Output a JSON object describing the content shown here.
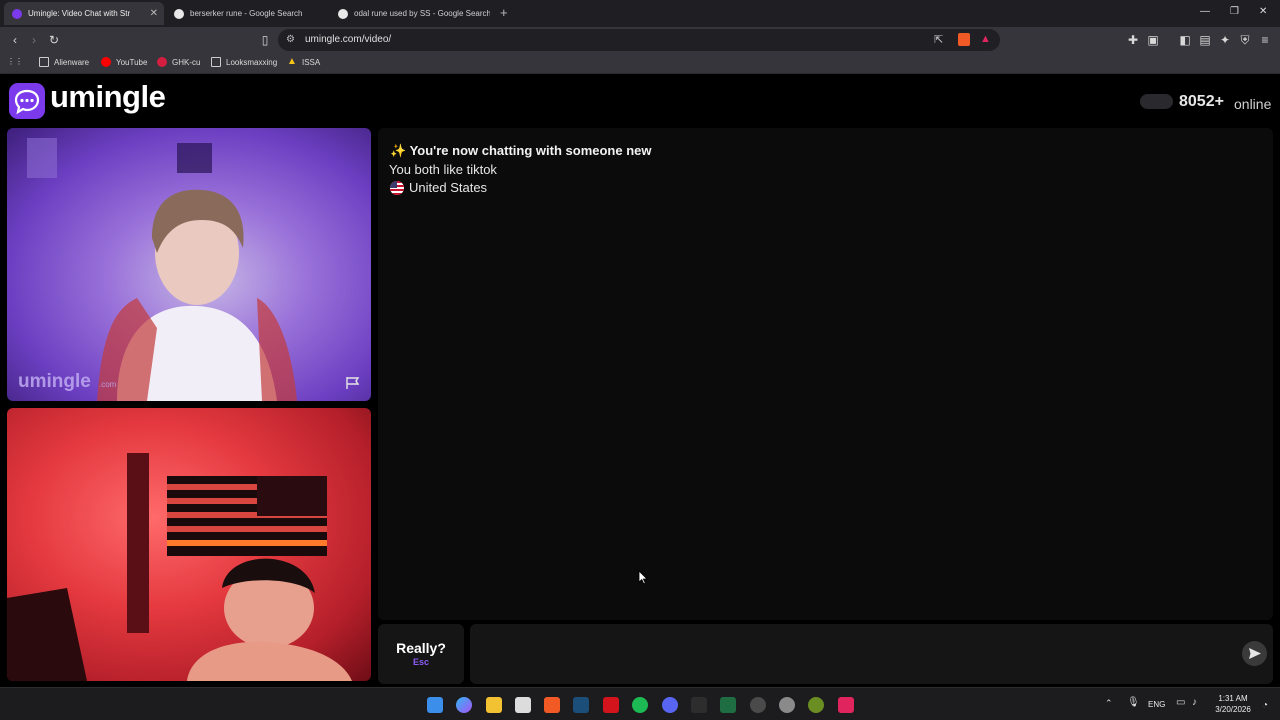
{
  "browser": {
    "tabs": [
      {
        "title": "Umingle: Video Chat with Str",
        "active": true
      },
      {
        "title": "berserker rune - Google Search",
        "active": false
      },
      {
        "title": "odal rune used by SS - Google Search",
        "active": false
      }
    ],
    "url": "umingle.com/video/",
    "bookmarks": [
      "Alienware",
      "YouTube",
      "GHK-cu",
      "Looksmaxxing",
      "ISSA"
    ]
  },
  "site": {
    "logo": "umingle",
    "online_count": "8052+",
    "online_label": "online",
    "accent_color": "#7c3aed"
  },
  "video": {
    "watermark": "umingle",
    "watermark_sub": ".com"
  },
  "chat": {
    "headline": "✨ You're now chatting with someone new",
    "interest": "You both like tiktok",
    "country": "United States"
  },
  "controls": {
    "skip_label": "Really?",
    "skip_key": "Esc",
    "message_placeholder": ""
  },
  "taskbar": {
    "language": "ENG",
    "time": "1:31 AM",
    "date": "3/20/2026"
  }
}
